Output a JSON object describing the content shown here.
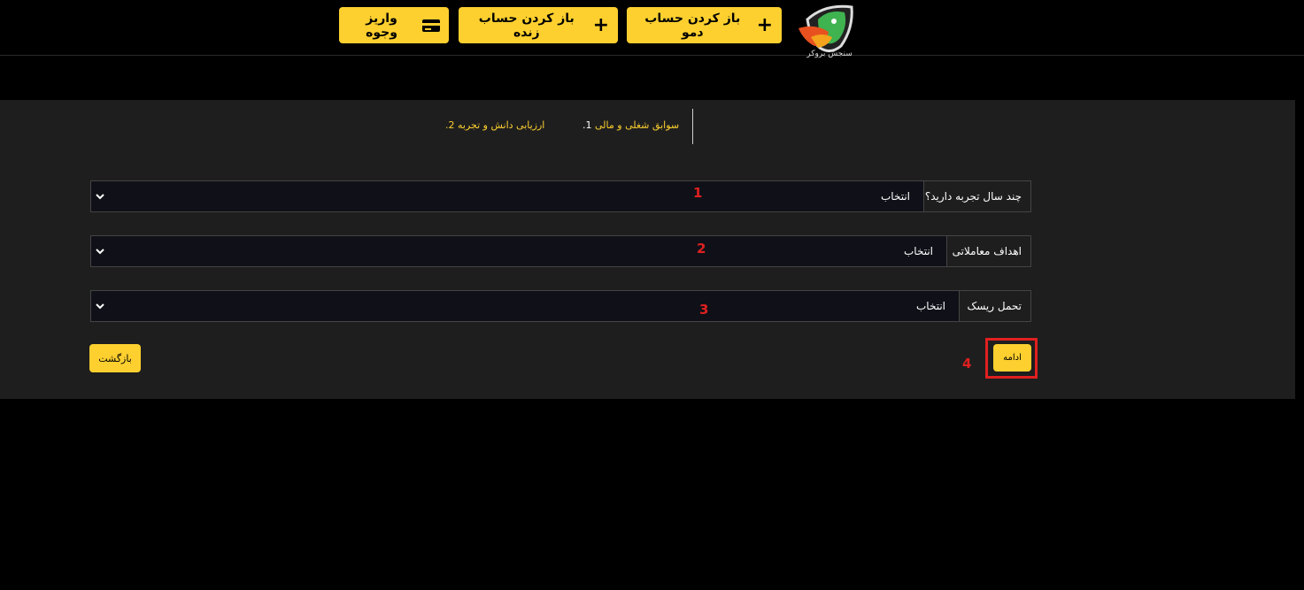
{
  "header": {
    "buttons": [
      {
        "label": "واریز وجوه",
        "icon": "credit-card-icon"
      },
      {
        "label": "باز کردن حساب زنده",
        "icon": "plus-icon"
      },
      {
        "label": "باز کردن حساب دمو",
        "icon": "plus-icon"
      }
    ],
    "logo_text": "سنجش بروکر"
  },
  "steps": [
    {
      "num": "1.",
      "label": "سوابق شغلی و مالی"
    },
    {
      "num": "2.",
      "label": "ارزیابی دانش و تجربه"
    }
  ],
  "form": {
    "rows": [
      {
        "label": "چند سال تجربه دارید؟",
        "value": "انتخاب",
        "marker": "1"
      },
      {
        "label": "اهداف معاملاتی",
        "value": "انتخاب",
        "marker": "2"
      },
      {
        "label": "تحمل ریسک",
        "value": "انتخاب",
        "marker": "3"
      }
    ],
    "back_label": "بازگشت",
    "continue_label": "ادامه",
    "continue_marker": "4"
  },
  "colors": {
    "accent": "#fdd02f",
    "marker": "#e02020",
    "background": "#000000",
    "panel": "#1e1e1e"
  }
}
